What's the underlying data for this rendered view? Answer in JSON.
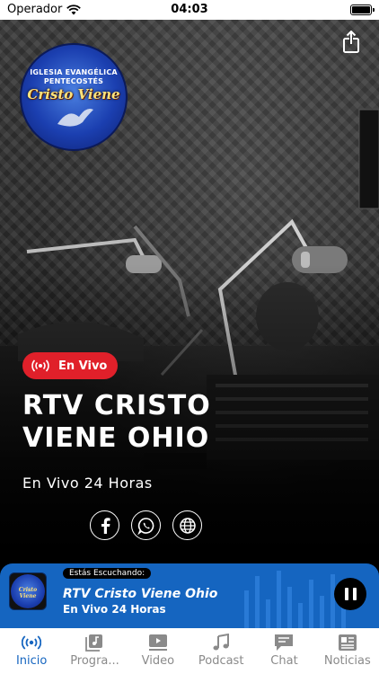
{
  "status_bar": {
    "carrier": "Operador",
    "time": "04:03"
  },
  "logo": {
    "line1": "IGLESIA EVANGÉLICA",
    "line2": "PENTECOSTÉS",
    "line3": "Cristo Viene"
  },
  "hero": {
    "live_badge": "En Vivo",
    "title": "RTV CRISTO VIENE OHIO",
    "subtitle": "En Vivo 24 Horas",
    "social_icons": [
      "facebook-icon",
      "whatsapp-icon",
      "globe-icon"
    ]
  },
  "player": {
    "listening_label": "Estás Escuchando:",
    "title": "RTV Cristo Viene Ohio",
    "subtitle": "En Vivo 24 Horas"
  },
  "tabs": [
    {
      "label": "Inicio",
      "icon": "broadcast-icon",
      "active": true
    },
    {
      "label": "Progra...",
      "icon": "playlist-icon",
      "active": false
    },
    {
      "label": "Video",
      "icon": "video-icon",
      "active": false
    },
    {
      "label": "Podcast",
      "icon": "music-note-icon",
      "active": false
    },
    {
      "label": "Chat",
      "icon": "chat-icon",
      "active": false
    },
    {
      "label": "Noticias",
      "icon": "newspaper-icon",
      "active": false
    }
  ],
  "colors": {
    "accent": "#1565c0",
    "live": "#e0202a",
    "tab_inactive": "#8a8a8a"
  }
}
